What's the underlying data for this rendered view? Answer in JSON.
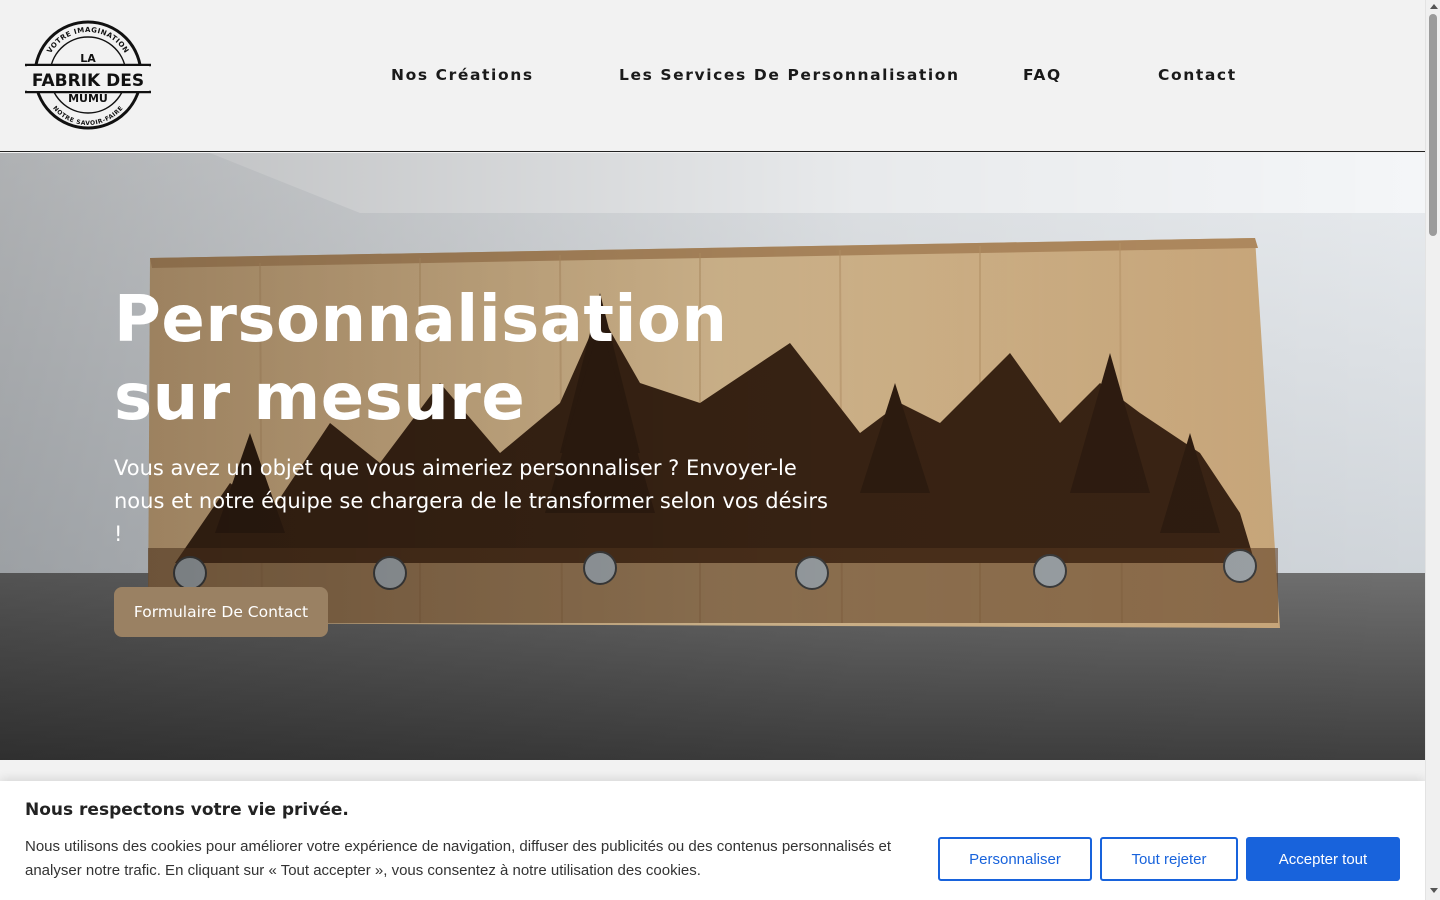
{
  "brand": {
    "name_line1": "LA",
    "name_line2": "FABRIK DES",
    "name_line3": "MUMU",
    "arc_top": "VOTRE IMAGINATION",
    "arc_bottom": "NOTRE SAVOIR-FAIRE"
  },
  "nav": {
    "items": [
      {
        "label": "Nos Créations"
      },
      {
        "label": "Les Services De Personnalisation"
      },
      {
        "label": "FAQ"
      },
      {
        "label": "Contact"
      }
    ]
  },
  "hero": {
    "title": "Personnalisation sur mesure",
    "text": "Vous avez un objet que vous aimeriez personnaliser ? Envoyer-le nous et notre équipe se chargera de le transformer selon vos désirs !",
    "button_label": "Formulaire De Contact",
    "button_color": "#9a8163"
  },
  "cookie": {
    "title": "Nous respectons votre vie privée.",
    "text": "Nous utilisons des cookies pour améliorer votre expérience de navigation, diffuser des publicités ou des contenus personnalisés et analyser notre trafic. En cliquant sur « Tout accepter », vous consentez à notre utilisation des cookies.",
    "buttons": {
      "customize": "Personnaliser",
      "reject": "Tout rejeter",
      "accept": "Accepter tout"
    },
    "accent_color": "#1863dc"
  }
}
